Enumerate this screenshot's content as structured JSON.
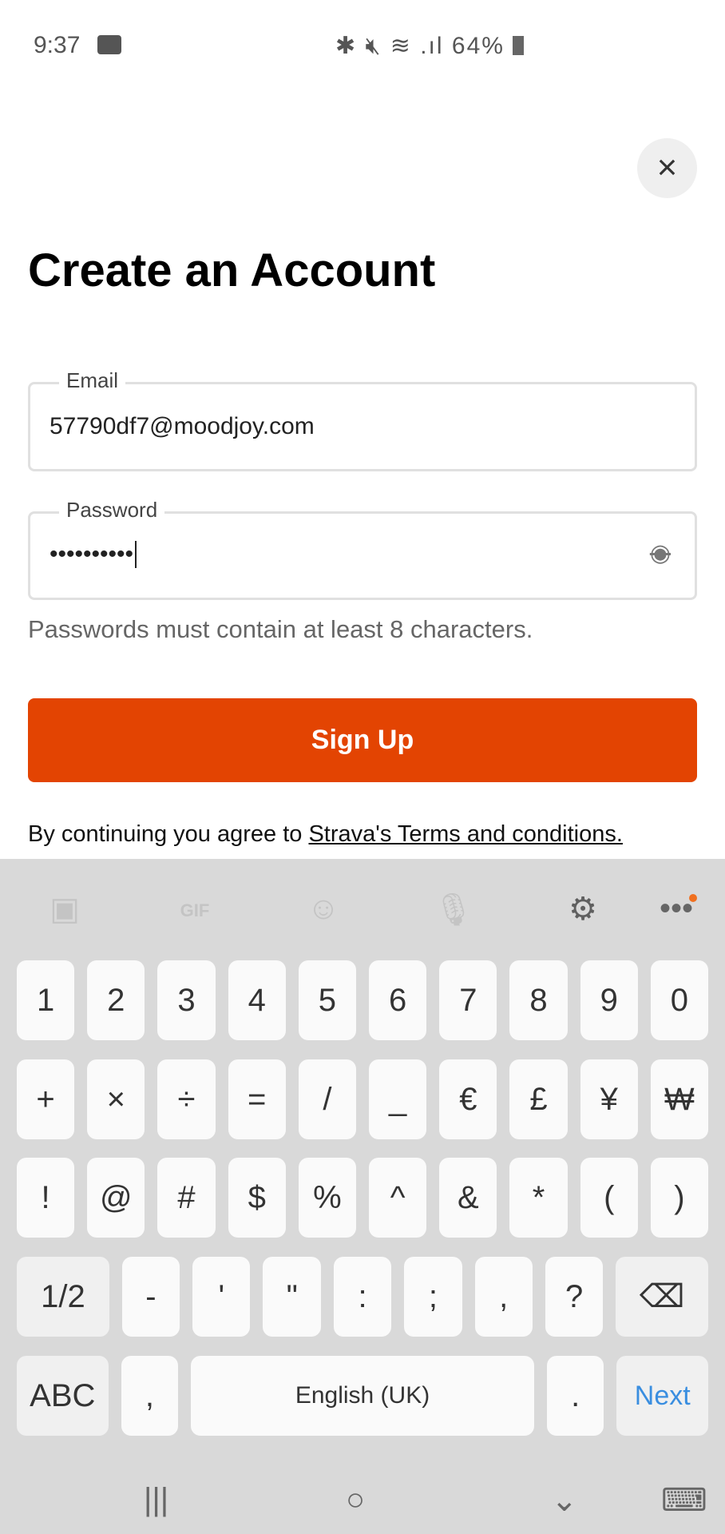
{
  "status_bar": {
    "time": "9:37",
    "icons": "bluetooth mute wifi signal",
    "battery": "64%"
  },
  "close_icon": "×",
  "title": "Create an Account",
  "email": {
    "label": "Email",
    "value": "57790df7@moodjoy.com"
  },
  "password": {
    "label": "Password",
    "value": "••••••••••",
    "toggle_icon": "eye-off-icon"
  },
  "helper": "Passwords must contain at least 8 characters.",
  "signup_label": "Sign Up",
  "terms": {
    "prefix": "By continuing you agree to ",
    "link": "Strava's Terms and conditions."
  },
  "accent": "#e34402",
  "keyboard": {
    "toolbar": [
      "sticker",
      "GIF",
      "emoji",
      "mic",
      "settings",
      "more"
    ],
    "row1": [
      "1",
      "2",
      "3",
      "4",
      "5",
      "6",
      "7",
      "8",
      "9",
      "0"
    ],
    "row2": [
      "+",
      "×",
      "÷",
      "=",
      "/",
      "_",
      "€",
      "£",
      "¥",
      "₩"
    ],
    "row3": [
      "!",
      "@",
      "#",
      "$",
      "%",
      "^",
      "&",
      "*",
      "(",
      ")"
    ],
    "row4": [
      "1/2",
      "-",
      "'",
      "\"",
      ":",
      ";",
      ",",
      "?",
      "⌫"
    ],
    "row5": [
      "ABC",
      ",",
      "English (UK)",
      ".",
      "Next"
    ]
  },
  "nav": {
    "recent": "|||",
    "home": "○",
    "back": "⌄",
    "keyboard": "⌨"
  }
}
